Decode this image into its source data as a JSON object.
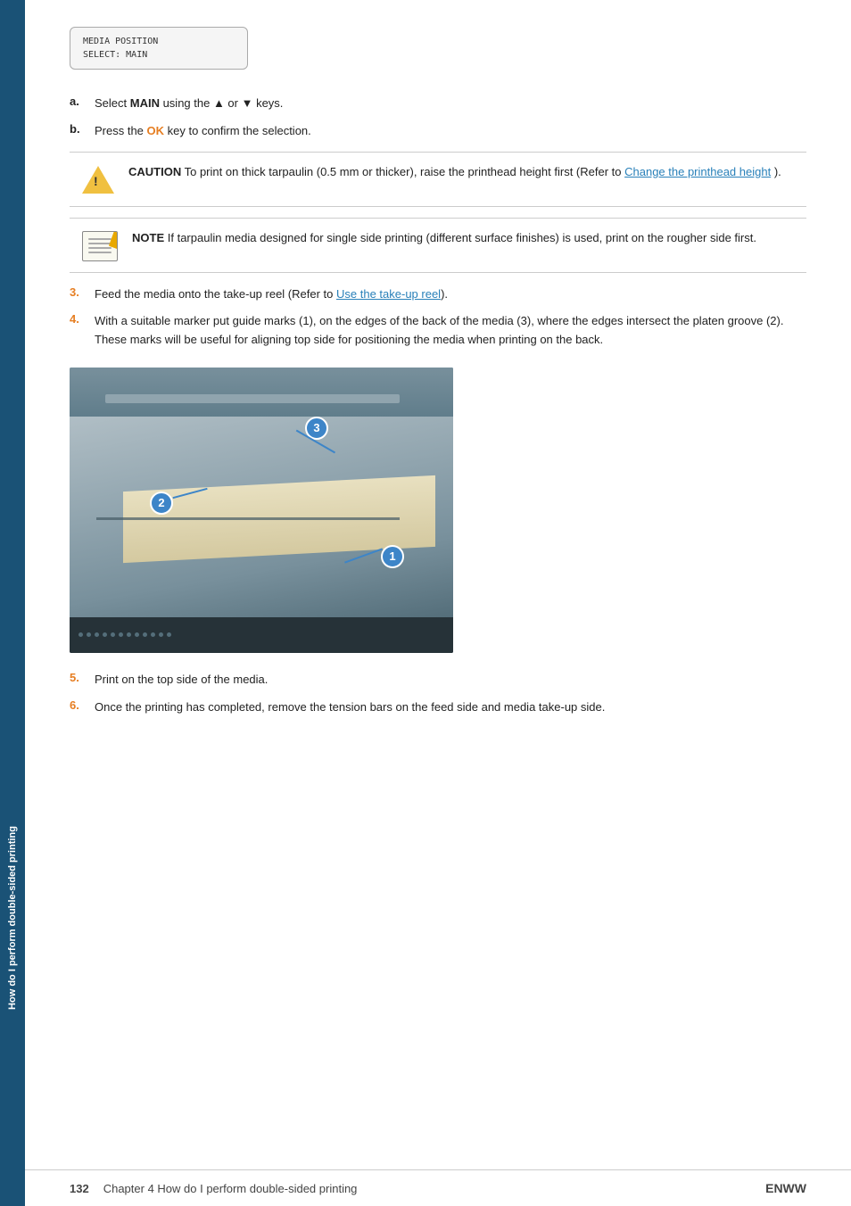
{
  "sidebar": {
    "text": "How do I perform double-sided printing"
  },
  "lcd": {
    "line1": "MEDIA POSITION",
    "line2": "SELECT: MAIN"
  },
  "steps": {
    "a": {
      "label": "a.",
      "text_parts": [
        "Select ",
        "MAIN",
        " using the ▲ or ▼ keys."
      ]
    },
    "b": {
      "label": "b.",
      "text_pre": "Press the ",
      "ok": "OK",
      "text_post": " key to confirm the selection."
    }
  },
  "caution": {
    "label": "CAUTION",
    "text": " To print on thick tarpaulin (0.5 mm or thicker), raise the printhead height first (Refer to ",
    "link": "Change the printhead height",
    "text_end": ")."
  },
  "note": {
    "label": "NOTE",
    "text": "  If tarpaulin media designed for single side printing (different surface finishes) is used, print on the rougher side first."
  },
  "step3": {
    "number": "3.",
    "text_pre": "Feed the media onto the take-up reel (Refer to ",
    "link": "Use the take-up reel",
    "text_end": ")."
  },
  "step4": {
    "number": "4.",
    "text": "With a suitable marker put guide marks (1), on the edges of the back of the media (3), where the edges intersect the platen groove (2). These marks will be useful for aligning top side for positioning the media when printing on the back."
  },
  "step5": {
    "number": "5.",
    "text": "Print on the top side of the media."
  },
  "step6": {
    "number": "6.",
    "text": "Once the printing has completed, remove the tension bars on the feed side and media take-up side."
  },
  "footer": {
    "page_number": "132",
    "chapter": "Chapter 4   How do I perform double-sided printing",
    "right": "ENWW"
  },
  "badges": [
    "1",
    "2",
    "3"
  ]
}
